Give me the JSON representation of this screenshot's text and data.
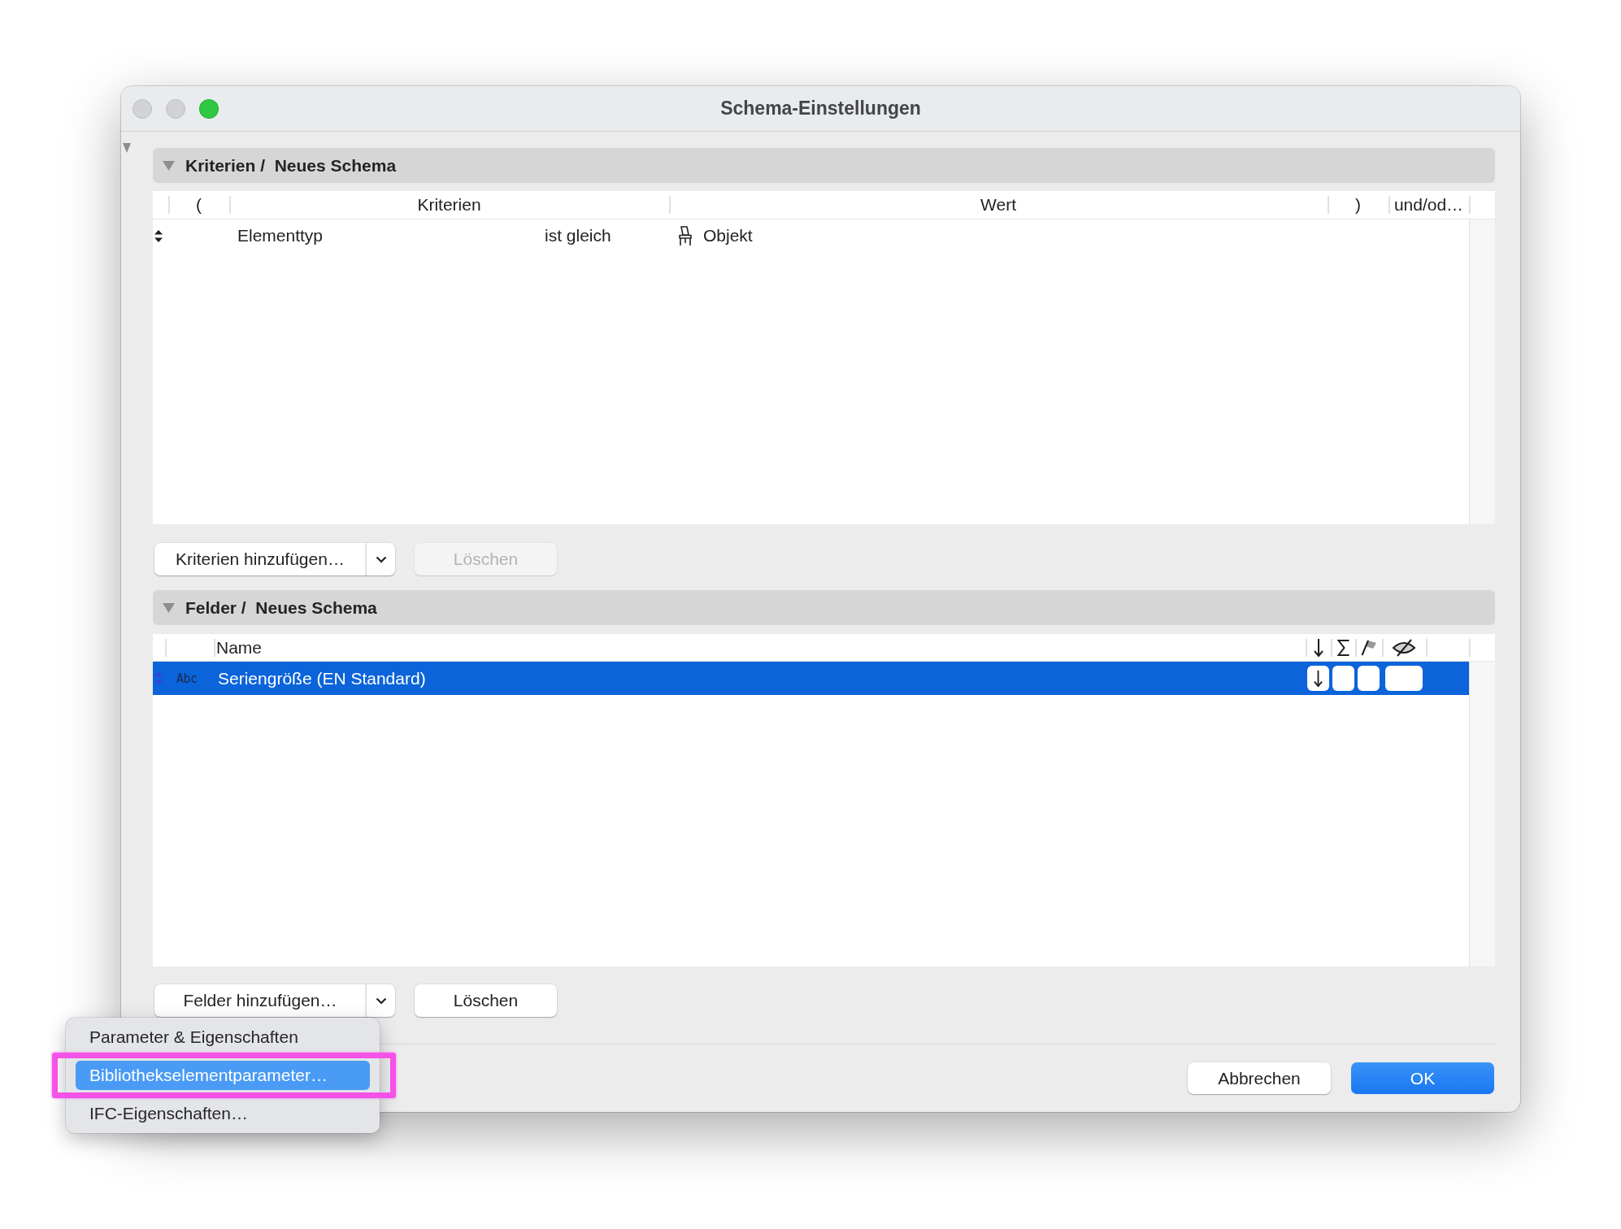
{
  "window": {
    "title": "Schema-Einstellungen",
    "controls": [
      {
        "kind": "close",
        "disabled": true
      },
      {
        "kind": "minimize",
        "disabled": true
      },
      {
        "kind": "zoom",
        "disabled": false
      }
    ]
  },
  "criteria": {
    "title": "Kriterien /  Neues Schema",
    "expanded": true,
    "columns": [
      "(",
      "Kriterien",
      "Wert",
      ")",
      "und/od…"
    ],
    "rows": [
      {
        "criterion": "Elementtyp",
        "operator": "ist gleich",
        "value": "Objekt",
        "selected": false
      }
    ],
    "add_button": {
      "label": "Kriterien hinzufügen…"
    },
    "delete_button": {
      "label": "Löschen",
      "disabled": true
    }
  },
  "fields": {
    "title": "Felder /  Neues Schema",
    "expanded": true,
    "columns": {
      "name": "Name",
      "icons": [
        {
          "kind": "sort"
        },
        {
          "kind": "sum"
        },
        {
          "kind": "flag"
        },
        {
          "kind": "hide"
        }
      ]
    },
    "rows": [
      {
        "type": "Abc",
        "name": "Seriengröße (EN Standard)",
        "selected": true,
        "flags": [
          {
            "kind": "sort",
            "on": true
          },
          {
            "kind": "sum",
            "on": false
          },
          {
            "kind": "flag",
            "on": false
          },
          {
            "kind": "hide",
            "on": false
          }
        ]
      }
    ],
    "add_button": {
      "label": "Felder hinzufügen…"
    },
    "delete_button": {
      "label": "Löschen",
      "disabled": false
    }
  },
  "add_fields_menu": {
    "items": [
      {
        "label": "Parameter & Eigenschaften",
        "selected": false,
        "annotated": false
      },
      {
        "label": "Bibliothekselementparameter…",
        "selected": true,
        "annotated": true
      },
      {
        "label": "IFC-Eigenschaften…",
        "selected": false,
        "annotated": false
      }
    ]
  },
  "footer_buttons": [
    {
      "label": "Abbrechen",
      "kind": "secondary"
    },
    {
      "label": "OK",
      "kind": "primary"
    }
  ]
}
